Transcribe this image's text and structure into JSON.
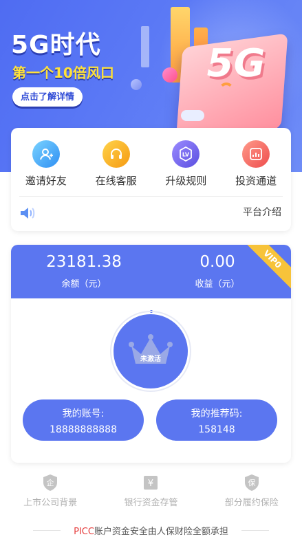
{
  "banner": {
    "title": "5G时代",
    "subtitle": "第一个10倍风口",
    "cta_label": "点击了解详情",
    "sign_text": "5G"
  },
  "menu": {
    "items": [
      {
        "label": "邀请好友",
        "icon": "invite-user-icon",
        "color": "#2f8ff3"
      },
      {
        "label": "在线客服",
        "icon": "headset-icon",
        "color": "#f59a12"
      },
      {
        "label": "升级规则",
        "icon": "level-badge-icon",
        "color": "#5b4fe0"
      },
      {
        "label": "投资通道",
        "icon": "invest-chart-icon",
        "color": "#ee4d4d"
      }
    ],
    "level_badge_text": "LV",
    "announcement_icon": "speaker-icon",
    "platform_intro": "平台介绍"
  },
  "account": {
    "balance_value": "23181.38",
    "balance_label": "余额（元）",
    "earnings_value": "0.00",
    "earnings_label": "收益（元）",
    "vip_label": "VIP0",
    "status_label": "未激活",
    "account_title": "我的账号:",
    "account_number": "18888888888",
    "referral_title": "我的推荐码:",
    "referral_code": "158148",
    "accent_color": "#5b76f0",
    "vip_color": "#f7c33a"
  },
  "badges": [
    {
      "label": "上市公司背景",
      "icon": "company-shield-icon",
      "glyph": "企"
    },
    {
      "label": "银行资金存管",
      "icon": "bank-deposit-icon",
      "glyph": "¥"
    },
    {
      "label": "部分履约保险",
      "icon": "insurance-shield-icon",
      "glyph": "保"
    }
  ],
  "notice": {
    "brand": "PICC",
    "text": "账户资金安全由人保财险全额承担"
  }
}
